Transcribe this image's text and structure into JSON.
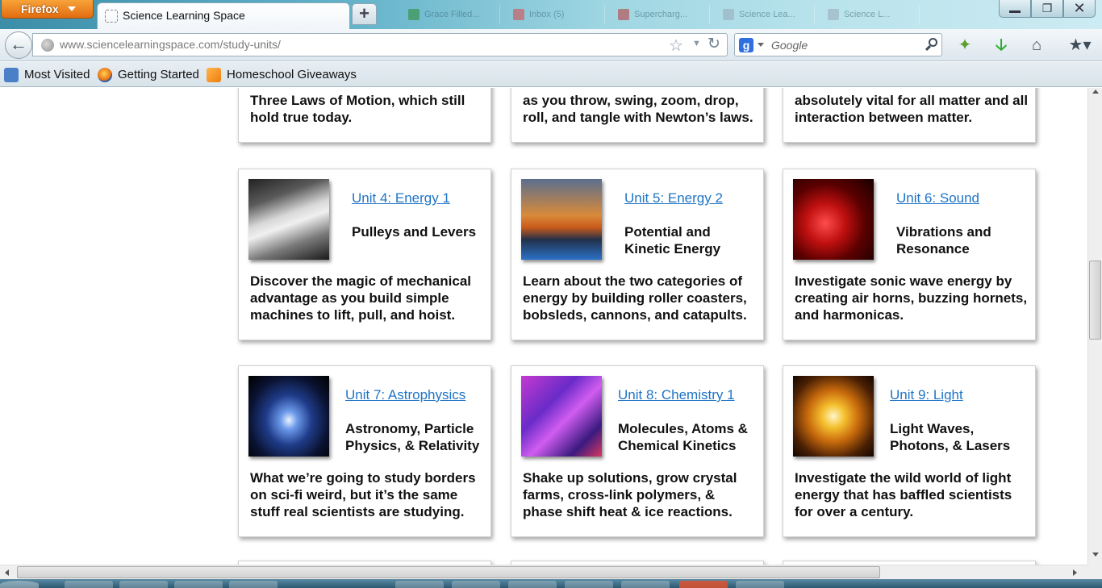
{
  "browser": {
    "app_button": "Firefox",
    "active_tab_title": "Science Learning Space",
    "background_tabs": [
      "Grace Filled...",
      "Inbox (5)",
      "Supercharg...",
      "Science Lea...",
      "Science L..."
    ],
    "url_host": "www.sciencelearningspace.com",
    "url_path": "/study-units/",
    "search_engine_letter": "g",
    "search_placeholder": "Google"
  },
  "bookmarks": [
    {
      "label": "Most Visited"
    },
    {
      "label": "Getting Started"
    },
    {
      "label": "Homeschool Giveaways"
    }
  ],
  "top_row": [
    {
      "desc": "Three Laws of Motion, which still hold true today."
    },
    {
      "desc": "as you throw, swing, zoom, drop, roll, and tangle with Newton’s laws."
    },
    {
      "desc": "absolutely vital for all matter and all interaction between matter."
    }
  ],
  "units": [
    {
      "title": "Unit 4: Energy 1",
      "subtitle": "Pulleys and Levers",
      "desc": "Discover the magic of mechanical advantage as you build simple machines to lift, pull, and hoist."
    },
    {
      "title": "Unit 5: Energy 2",
      "subtitle": "Potential and Kinetic Energy",
      "desc": "Learn about the two categories of energy by building roller coasters, bobsleds, cannons, and catapults."
    },
    {
      "title": "Unit 6: Sound",
      "subtitle": "Vibrations and Resonance",
      "desc": "Investigate sonic wave energy by creating air horns, buzzing hornets, and harmonicas."
    },
    {
      "title": "Unit 7: Astrophysics",
      "subtitle": "Astronomy, Particle Physics, & Relativity",
      "desc": "What we’re going to study borders on sci-fi weird, but it’s the same stuff real scientists are studying."
    },
    {
      "title": "Unit 8: Chemistry 1",
      "subtitle": "Molecules, Atoms & Chemical Kinetics",
      "desc": "Shake up solutions, grow crystal farms, cross-link polymers, & phase shift heat & ice reactions."
    },
    {
      "title": "Unit 9: Light",
      "subtitle": "Light Waves, Photons, & Lasers",
      "desc": "Investigate the wild world of light energy that has baffled scientists for over a century."
    }
  ],
  "colors": {
    "link": "#1f74c6",
    "firefox_orange": "#e26c0f"
  }
}
